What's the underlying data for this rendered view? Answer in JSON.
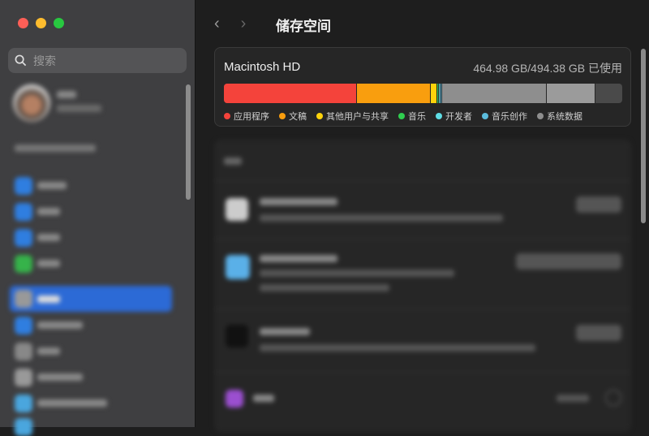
{
  "window": {
    "title": "储存空间",
    "back_icon": "chevron-left",
    "forward_icon": "chevron-right"
  },
  "sidebar": {
    "search_placeholder": "搜索"
  },
  "storage": {
    "disk_name": "Macintosh HD",
    "usage_text": "464.98 GB/494.38 GB 已使用",
    "used_gb": 464.98,
    "total_gb": 494.38,
    "categories": [
      {
        "label": "应用程序",
        "color": "#f4433b",
        "percent": 33.5
      },
      {
        "label": "文稿",
        "color": "#f99e0e",
        "percent": 18.4
      },
      {
        "label": "其他用户与共享",
        "color": "#fdd30b",
        "percent": 1.6
      },
      {
        "label": "音乐",
        "color": "#2fce4f",
        "percent": 0.4
      },
      {
        "label": "开发者",
        "color": "#5fdde4",
        "percent": 0.4
      },
      {
        "label": "音乐创作",
        "color": "#5bbcdd",
        "percent": 0.4
      },
      {
        "label": "系统数据",
        "color": "#8e8e8e",
        "percent": 26.3
      }
    ],
    "other_percent": 12.2,
    "other_color": "#9b9b9b"
  }
}
